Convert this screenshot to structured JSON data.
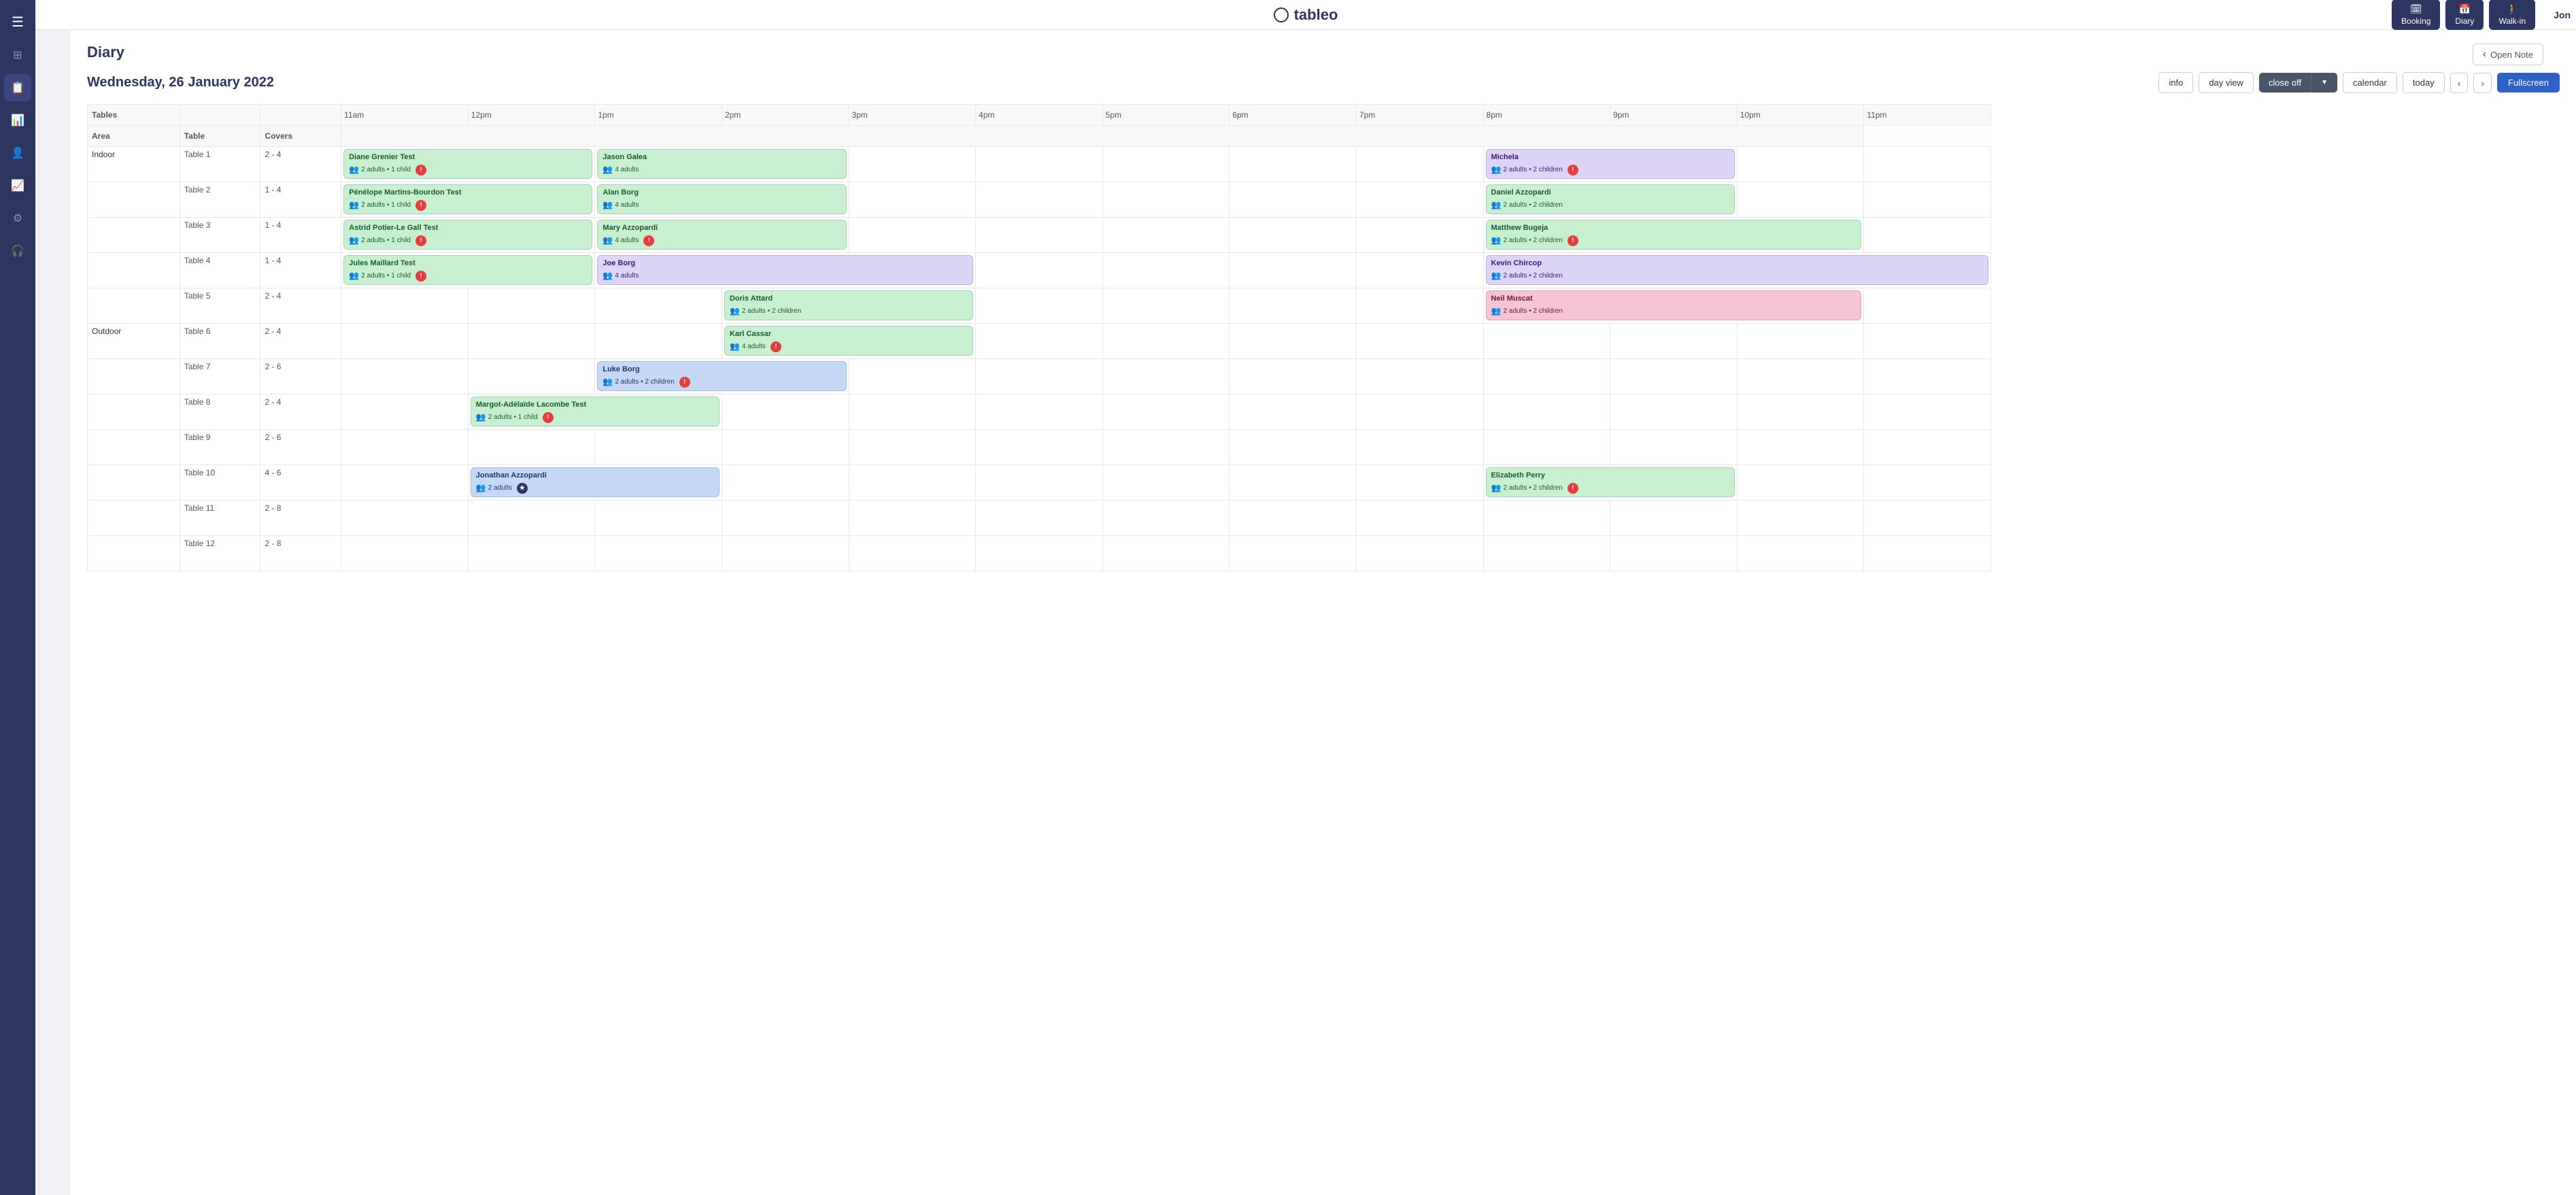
{
  "app": {
    "logo_text": "tableo",
    "user": "Jon"
  },
  "topbar_buttons": [
    {
      "id": "booking",
      "label": "Booking",
      "icon": "🗓"
    },
    {
      "id": "diary",
      "label": "Diary",
      "icon": "📅"
    },
    {
      "id": "walkin",
      "label": "Walk-in",
      "icon": "🚶"
    }
  ],
  "sidebar_icons": [
    {
      "id": "menu",
      "icon": "☰",
      "active": false
    },
    {
      "id": "dashboard",
      "icon": "⊞",
      "active": false
    },
    {
      "id": "bookings",
      "icon": "📋",
      "active": true
    },
    {
      "id": "reports",
      "icon": "📊",
      "active": false
    },
    {
      "id": "users",
      "icon": "👤",
      "active": false
    },
    {
      "id": "analytics",
      "icon": "📈",
      "active": false
    },
    {
      "id": "settings",
      "icon": "⚙",
      "active": false
    },
    {
      "id": "support",
      "icon": "🎧",
      "active": false
    }
  ],
  "page": {
    "title": "Diary",
    "open_note": "Open Note"
  },
  "toolbar": {
    "date": "Wednesday, 26 January 2022",
    "info_btn": "info",
    "day_view_btn": "day view",
    "close_off_btn": "close off",
    "calendar_btn": "calendar",
    "today_btn": "today",
    "fullscreen_btn": "Fullscreen"
  },
  "tables_section": "Tables",
  "columns": {
    "area": "Area",
    "table": "Table",
    "covers": "Covers",
    "times": [
      "11am",
      "12pm",
      "1pm",
      "2pm",
      "3pm",
      "4pm",
      "5pm",
      "6pm",
      "7pm",
      "8pm",
      "9pm",
      "10pm",
      "11pm"
    ]
  },
  "rows": [
    {
      "area": "Indoor",
      "table": "Table 1",
      "covers": "2 - 4",
      "bookings": [
        {
          "name": "Diane Grenier Test",
          "covers": "2 adults • 1 child",
          "color": "green",
          "badge": "alert",
          "col_start": 0,
          "col_span": 2
        },
        {
          "name": "Jason Galea",
          "covers": "4 adults",
          "color": "green",
          "badge": null,
          "col_start": 2,
          "col_span": 2
        },
        {
          "name": "Michela",
          "covers": "2 adults • 2 children",
          "color": "purple",
          "badge": "alert",
          "col_start": 9,
          "col_span": 2
        }
      ]
    },
    {
      "area": "",
      "table": "Table 2",
      "covers": "1 - 4",
      "bookings": [
        {
          "name": "Pénélope Martins-Bourdon Test",
          "covers": "2 adults • 1 child",
          "color": "green",
          "badge": "alert",
          "col_start": 0,
          "col_span": 2
        },
        {
          "name": "Alan Borg",
          "covers": "4 adults",
          "color": "green",
          "badge": null,
          "col_start": 2,
          "col_span": 2
        },
        {
          "name": "Daniel Azzopardi",
          "covers": "2 adults • 2 children",
          "color": "green",
          "badge": null,
          "col_start": 9,
          "col_span": 2
        }
      ]
    },
    {
      "area": "",
      "table": "Table 3",
      "covers": "1 - 4",
      "bookings": [
        {
          "name": "Astrid Potier-Le Gall Test",
          "covers": "2 adults • 1 child",
          "color": "green",
          "badge": "alert",
          "col_start": 0,
          "col_span": 2
        },
        {
          "name": "Mary Azzopardi",
          "covers": "4 adults",
          "color": "green",
          "badge": "alert",
          "col_start": 2,
          "col_span": 2
        },
        {
          "name": "Matthew Bugeja",
          "covers": "2 adults • 2 children",
          "color": "green",
          "badge": "alert",
          "col_start": 9,
          "col_span": 3
        }
      ]
    },
    {
      "area": "",
      "table": "Table 4",
      "covers": "1 - 4",
      "bookings": [
        {
          "name": "Jules Maillard Test",
          "covers": "2 adults • 1 child",
          "color": "green",
          "badge": "alert",
          "col_start": 0,
          "col_span": 2
        },
        {
          "name": "Joe Borg",
          "covers": "4 adults",
          "color": "purple",
          "badge": null,
          "col_start": 2,
          "col_span": 3
        },
        {
          "name": "Kevin Chircop",
          "covers": "2 adults • 2 children",
          "color": "purple",
          "badge": null,
          "col_start": 9,
          "col_span": 4
        }
      ]
    },
    {
      "area": "",
      "table": "Table 5",
      "covers": "2 - 4",
      "bookings": [
        {
          "name": "Doris Attard",
          "covers": "2 adults • 2 children",
          "color": "green",
          "badge": null,
          "col_start": 3,
          "col_span": 2
        },
        {
          "name": "Neil Muscat",
          "covers": "2 adults • 2 children",
          "color": "pink",
          "badge": null,
          "col_start": 9,
          "col_span": 3
        }
      ]
    },
    {
      "area": "Outdoor",
      "table": "Table 6",
      "covers": "2 - 4",
      "bookings": [
        {
          "name": "Karl Cassar",
          "covers": "4 adults",
          "color": "green",
          "badge": "alert",
          "col_start": 3,
          "col_span": 2
        }
      ]
    },
    {
      "area": "",
      "table": "Table 7",
      "covers": "2 - 6",
      "bookings": [
        {
          "name": "Luke Borg",
          "covers": "2 adults • 2 children",
          "color": "blue",
          "badge": "alert",
          "col_start": 2,
          "col_span": 2
        }
      ]
    },
    {
      "area": "",
      "table": "Table 8",
      "covers": "2 - 4",
      "bookings": [
        {
          "name": "Margot-Adélaïde Lacombe Test",
          "covers": "2 adults • 1 child",
          "color": "green",
          "badge": "alert",
          "col_start": 1,
          "col_span": 2
        }
      ]
    },
    {
      "area": "",
      "table": "Table 9",
      "covers": "2 - 6",
      "bookings": []
    },
    {
      "area": "",
      "table": "Table 10",
      "covers": "4 - 6",
      "bookings": [
        {
          "name": "Jonathan Azzopardi",
          "covers": "2 adults",
          "color": "blue",
          "badge": "star",
          "col_start": 1,
          "col_span": 2
        },
        {
          "name": "Elizabeth Perry",
          "covers": "2 adults • 2 children",
          "color": "green",
          "badge": "alert",
          "col_start": 9,
          "col_span": 2
        }
      ]
    },
    {
      "area": "",
      "table": "Table 11",
      "covers": "2 - 8",
      "bookings": []
    },
    {
      "area": "",
      "table": "Table 12",
      "covers": "2 - 8",
      "bookings": []
    }
  ]
}
